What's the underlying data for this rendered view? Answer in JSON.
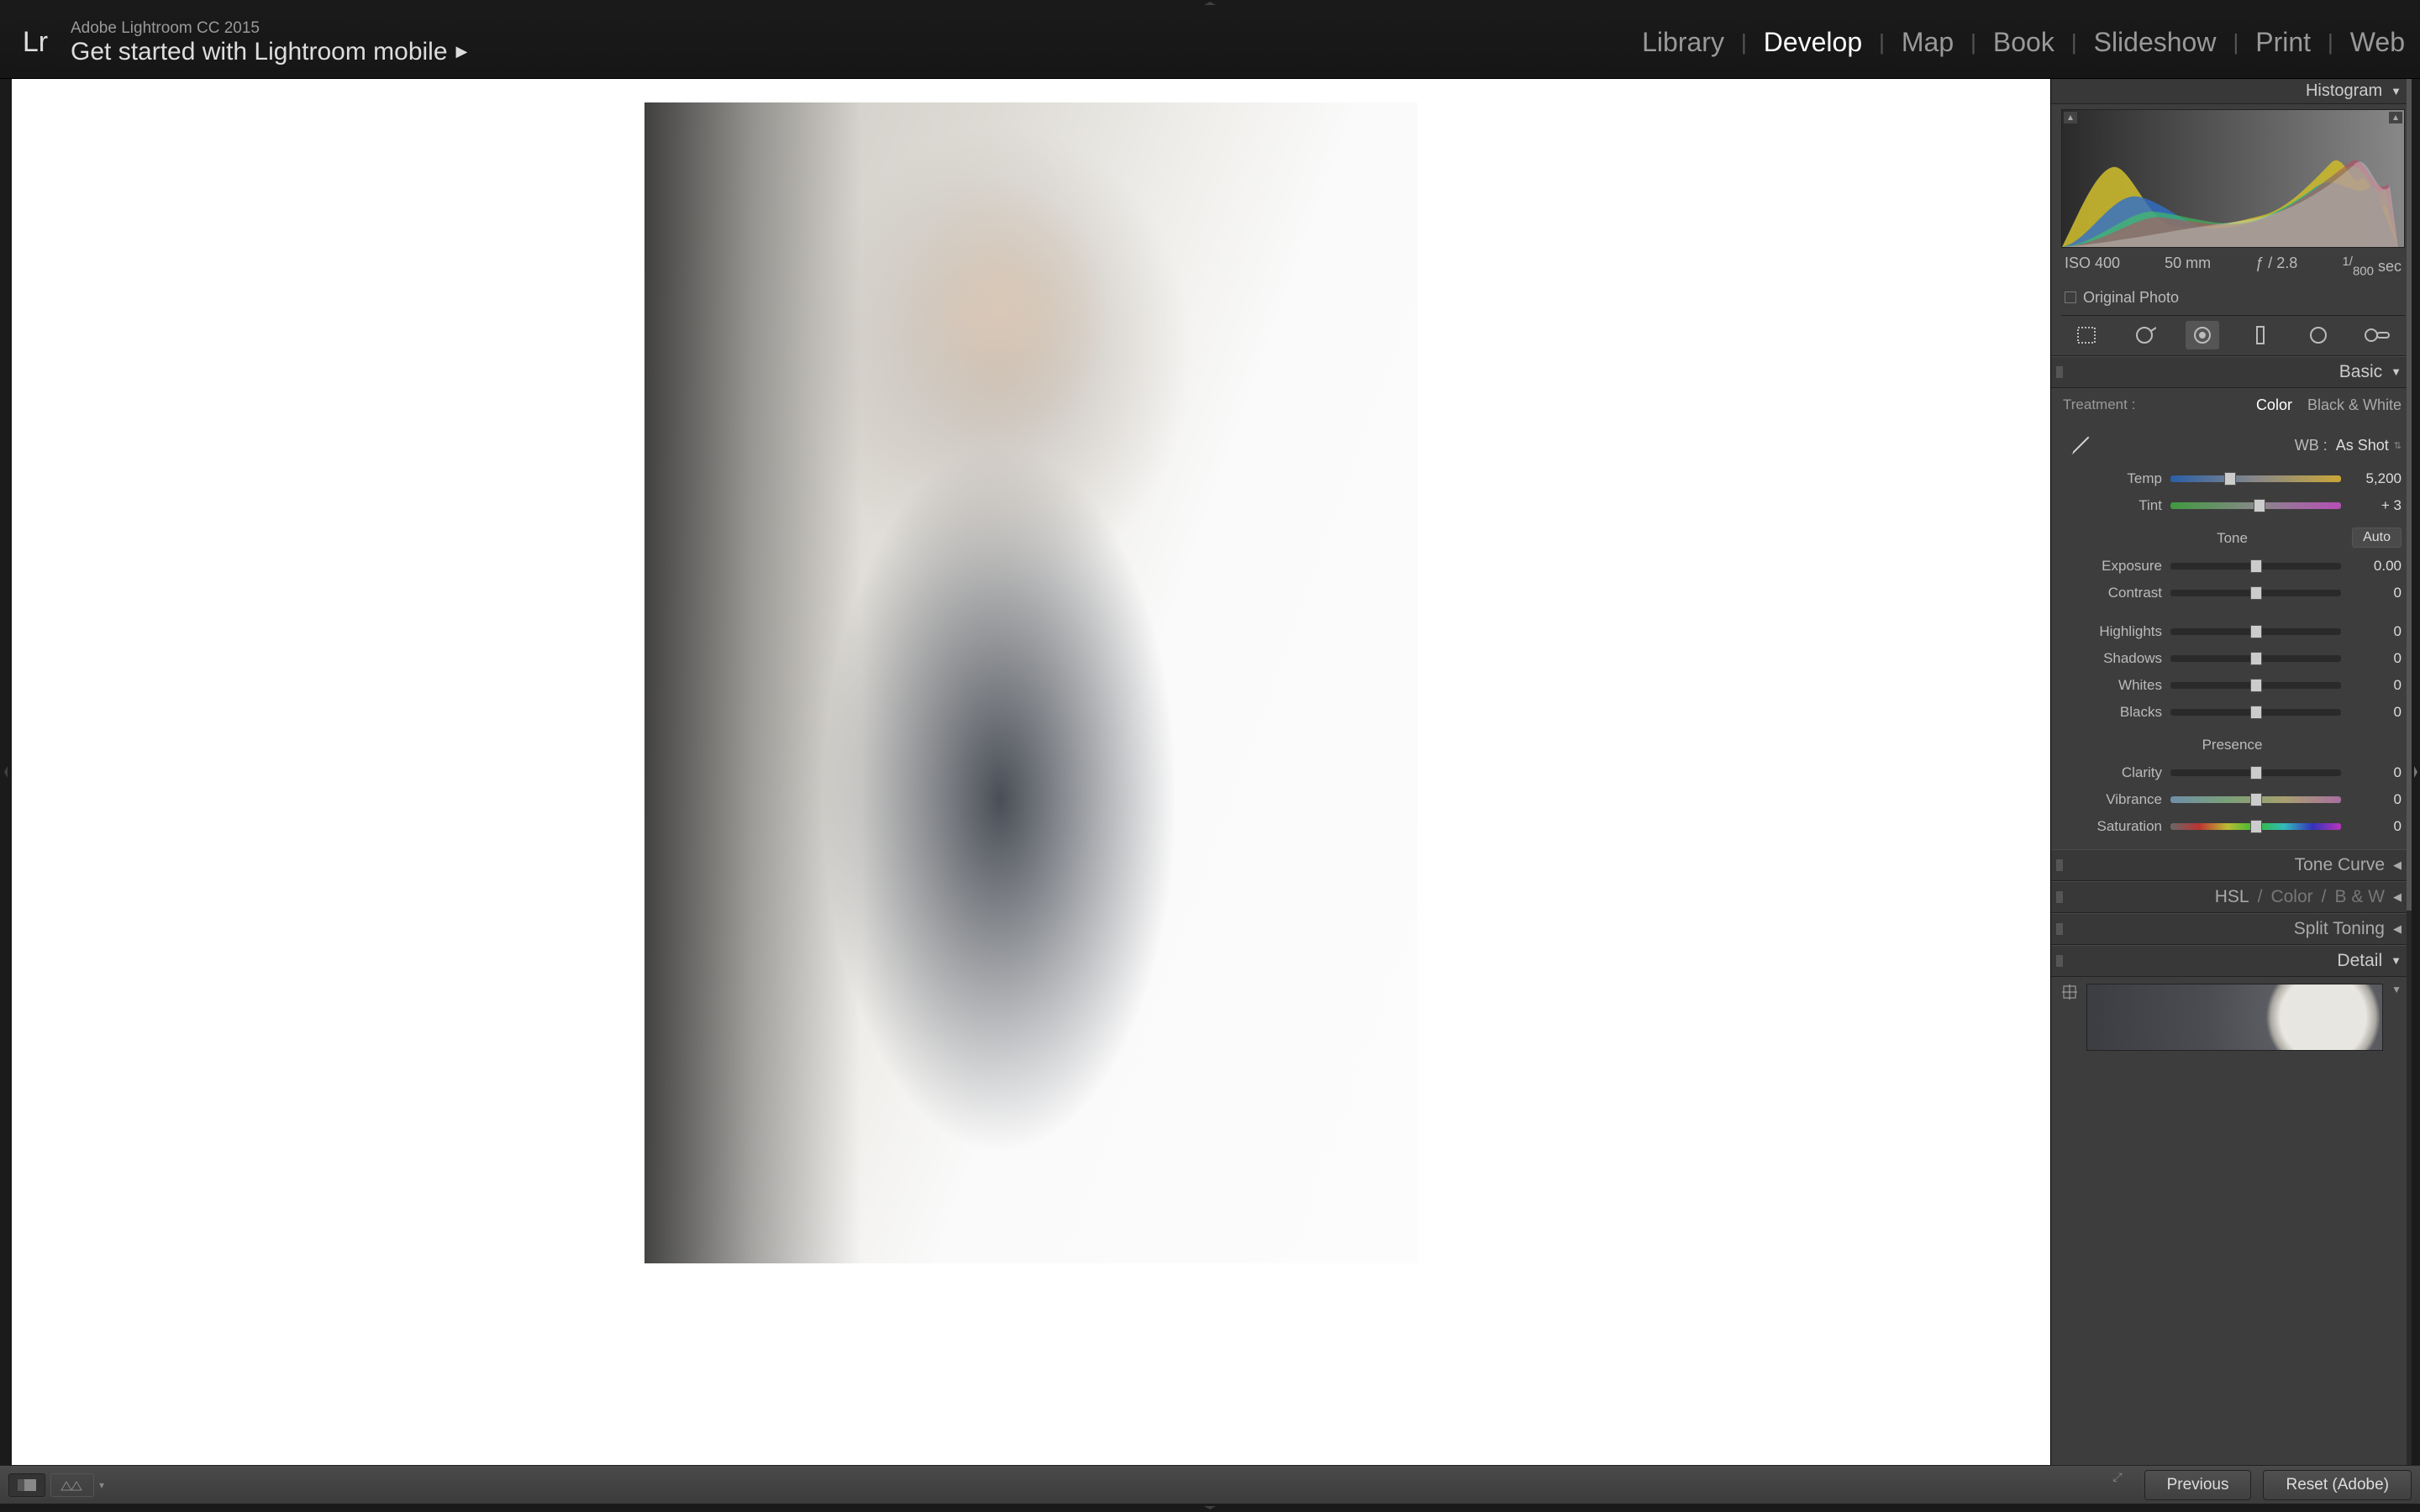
{
  "app": {
    "title": "Adobe Lightroom CC 2015",
    "subtitle": "Get started with Lightroom mobile"
  },
  "nav": {
    "items": [
      "Library",
      "Develop",
      "Map",
      "Book",
      "Slideshow",
      "Print",
      "Web"
    ],
    "active": "Develop"
  },
  "histogram": {
    "title": "Histogram",
    "meta": {
      "iso": "ISO 400",
      "focal": "50 mm",
      "aperture": "ƒ / 2.8",
      "shutter_pre": "1/",
      "shutter_den": "800",
      "shutter_suf": " sec"
    },
    "original_label": "Original Photo"
  },
  "tools": [
    "crop",
    "spot",
    "redeye",
    "gradient",
    "radial",
    "brush"
  ],
  "basic": {
    "title": "Basic",
    "treatment_label": "Treatment :",
    "treatment_options": [
      "Color",
      "Black & White"
    ],
    "treatment_active": "Color",
    "wb_label": "WB :",
    "wb_value": "As Shot",
    "sliders": {
      "temp": {
        "label": "Temp",
        "value": "5,200",
        "pos": 35,
        "gradient": "gradient-temp"
      },
      "tint": {
        "label": "Tint",
        "value": "+ 3",
        "pos": 52,
        "gradient": "gradient-tint"
      },
      "exposure": {
        "label": "Exposure",
        "value": "0.00",
        "pos": 50
      },
      "contrast": {
        "label": "Contrast",
        "value": "0",
        "pos": 50
      },
      "highlights": {
        "label": "Highlights",
        "value": "0",
        "pos": 50
      },
      "shadows": {
        "label": "Shadows",
        "value": "0",
        "pos": 50
      },
      "whites": {
        "label": "Whites",
        "value": "0",
        "pos": 50
      },
      "blacks": {
        "label": "Blacks",
        "value": "0",
        "pos": 50
      },
      "clarity": {
        "label": "Clarity",
        "value": "0",
        "pos": 50
      },
      "vibrance": {
        "label": "Vibrance",
        "value": "0",
        "pos": 50,
        "gradient": "gradient-vib"
      },
      "saturation": {
        "label": "Saturation",
        "value": "0",
        "pos": 50,
        "gradient": "gradient-sat"
      }
    },
    "tone_label": "Tone",
    "auto_label": "Auto",
    "presence_label": "Presence"
  },
  "sections": {
    "tone_curve": "Tone Curve",
    "hsl": "HSL",
    "color": "Color",
    "bw": "B & W",
    "split": "Split Toning",
    "detail": "Detail"
  },
  "footer": {
    "previous": "Previous",
    "reset": "Reset (Adobe)"
  }
}
